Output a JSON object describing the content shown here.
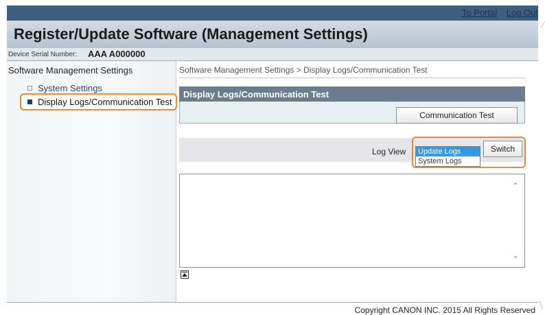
{
  "header": {
    "links": [
      "To Portal",
      "Log Out"
    ],
    "title": "Register/Update Software (Management Settings)",
    "serial_label": "Device Serial Number:",
    "serial_value": "AAA A000000"
  },
  "sidebar": {
    "title": "Software Management Settings",
    "items": [
      {
        "label": "System Settings"
      },
      {
        "label": "Display Logs/Communication Test"
      }
    ]
  },
  "main": {
    "breadcrumb": "Software Management Settings > Display Logs/Communication Test",
    "panel_title": "Display Logs/Communication Test",
    "comm_test_button": "Communication Test",
    "log_view_label": "Log View",
    "log_options": [
      "Update Logs",
      "System Logs"
    ],
    "selected_option": "Update Logs",
    "switch_button": "Switch",
    "log_content": ""
  },
  "footer": {
    "copyright": "Copyright CANON INC. 2015 All Rights Reserved"
  },
  "colors": {
    "highlight": "#ea8a2a",
    "panel_header": "#6b7c8e",
    "top_bar": "#3f5d7c",
    "selected_option_bg": "#3399e0"
  }
}
